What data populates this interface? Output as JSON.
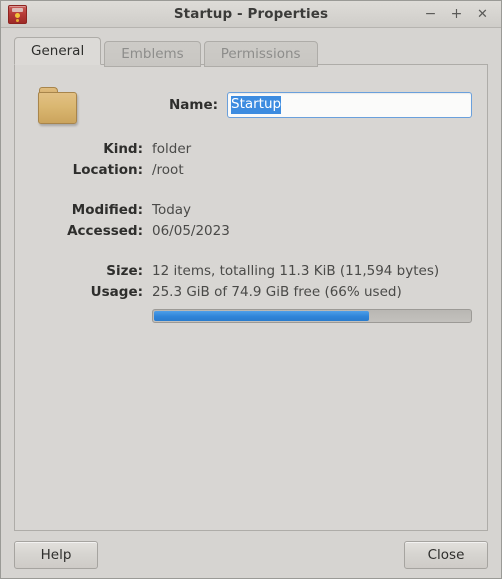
{
  "window": {
    "title": "Startup - Properties",
    "icon": "app-archive-icon",
    "controls": {
      "minimize": "−",
      "maximize": "+",
      "close": "✕"
    }
  },
  "tabs": [
    {
      "label": "General",
      "active": true
    },
    {
      "label": "Emblems",
      "active": false
    },
    {
      "label": "Permissions",
      "active": false
    }
  ],
  "general": {
    "folder_icon": "folder-icon",
    "name": {
      "label": "Name:",
      "value": "Startup",
      "selected": true
    },
    "fields": [
      {
        "label": "Kind:",
        "value": "folder"
      },
      {
        "label": "Location:",
        "value": "/root"
      }
    ],
    "dates": [
      {
        "label": "Modified:",
        "value": "Today"
      },
      {
        "label": "Accessed:",
        "value": "06/05/2023"
      }
    ],
    "sizes": [
      {
        "label": "Size:",
        "value": "12 items, totalling 11.3 KiB (11,594 bytes)"
      },
      {
        "label": "Usage:",
        "value": "25.3 GiB of 74.9 GiB free (66% used)"
      }
    ],
    "usage_bar": {
      "percent": 68,
      "fill_color": "#2f84d8",
      "track_color": "#bdbbb7"
    }
  },
  "actions": {
    "help_label": "Help",
    "close_label": "Close"
  },
  "colors": {
    "window_bg": "#d6d4d1",
    "page_bg": "#d8d6d3",
    "accent": "#3d8ce0",
    "folder": "#dab771",
    "text": "#2e2e2c",
    "text_muted": "#8d8d8b"
  }
}
